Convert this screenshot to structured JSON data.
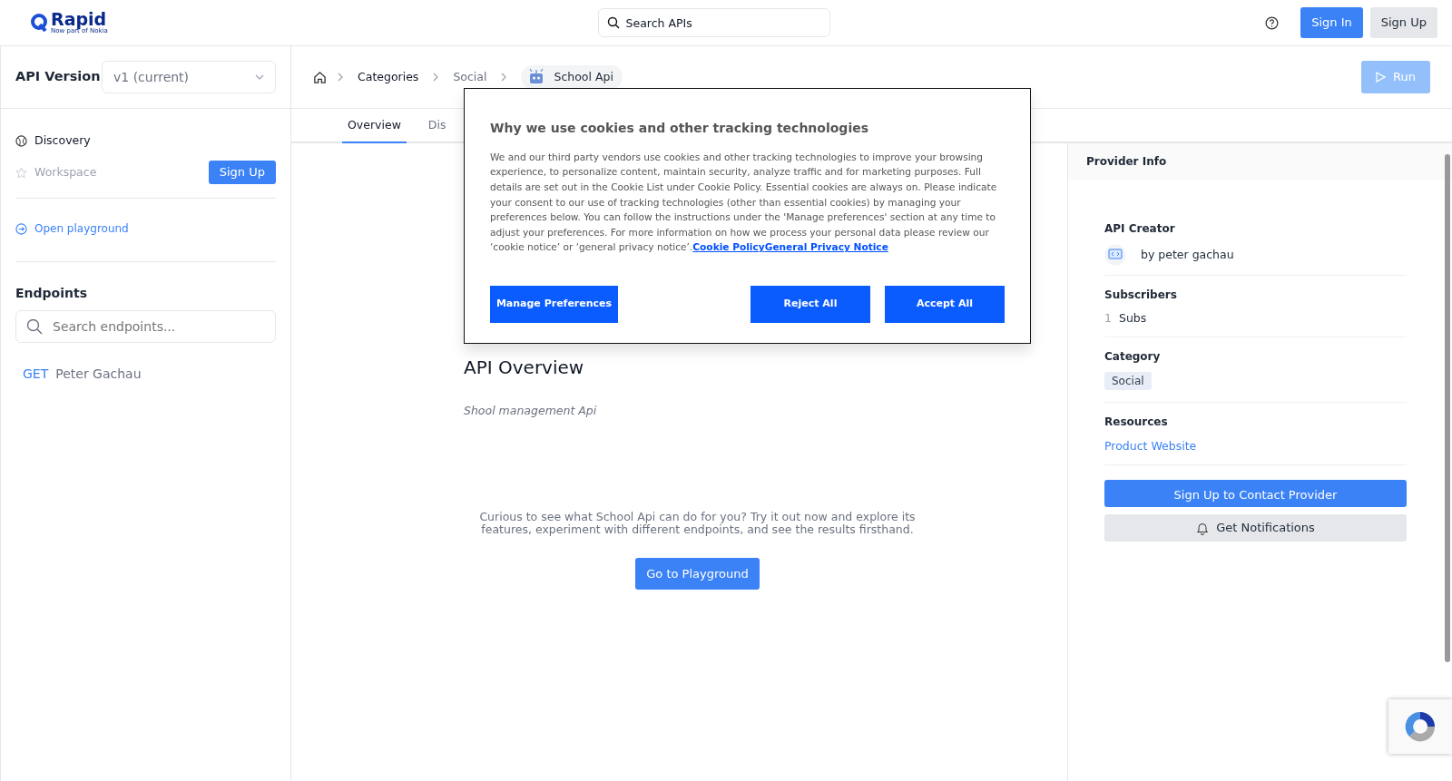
{
  "header": {
    "logo": {
      "name": "Rapid",
      "tagline": "Now part of Nokia"
    },
    "search": {
      "placeholder": "Search APIs"
    },
    "sign_in": "Sign In",
    "sign_up": "Sign Up"
  },
  "sidebar": {
    "version_label": "API Version",
    "version_value": "v1 (current)",
    "nav": [
      {
        "label": "Discovery",
        "disabled": false
      },
      {
        "label": "Workspace",
        "disabled": true
      }
    ],
    "sign_up": "Sign Up",
    "open_playground": "Open playground",
    "endpoints_title": "Endpoints",
    "endpoints_search": {
      "placeholder": "Search endpoints..."
    },
    "endpoints": [
      {
        "method": "GET",
        "name": "Peter Gachau"
      }
    ]
  },
  "breadcrumb": {
    "items": [
      "Categories",
      "Social"
    ],
    "api_name": "School Api"
  },
  "run_button": {
    "label": "Run",
    "disabled": true
  },
  "tabs": [
    {
      "label": "Overview",
      "selected": true
    },
    {
      "label": "Dis",
      "selected": false
    }
  ],
  "overview": {
    "title": "API Overview",
    "description": "Shool management Api",
    "cta_text": "Curious to see what School Api can do for you? Try it out now and explore its features, experiment with different endpoints, and see the results firsthand.",
    "cta_button": "Go to Playground"
  },
  "provider_info": {
    "title": "Provider Info",
    "creator_label": "API Creator",
    "creator": "by peter gachau",
    "subscribers_label": "Subscribers",
    "subscribers_count": "1",
    "subscribers_unit": "Subs",
    "category_label": "Category",
    "category": "Social",
    "resources_label": "Resources",
    "resource_link": "Product Website",
    "contact_button": "Sign Up to Contact Provider",
    "notify_button": "Get Notifications"
  },
  "cookie_dialog": {
    "title": "Why we use cookies and other tracking technologies",
    "body": "We and our third party vendors use cookies and other tracking technologies to improve your browsing experience, to personalize content, maintain security, analyze traffic and for marketing purposes. Full details are set out in the Cookie List under Cookie Policy. Essential cookies are always on. Please indicate your consent to our use of tracking technologies (other than essential cookies) by managing your preferences below. You can follow the instructions under the 'Manage preferences' section at any time to adjust your preferences. For more information on how we process your personal data please review our ‘cookie notice’ or ‘general privacy notice’.",
    "links": [
      "Cookie Policy",
      "General Privacy Notice"
    ],
    "manage_button": "Manage Preferences",
    "reject_button": "Reject All",
    "accept_button": "Accept All"
  }
}
